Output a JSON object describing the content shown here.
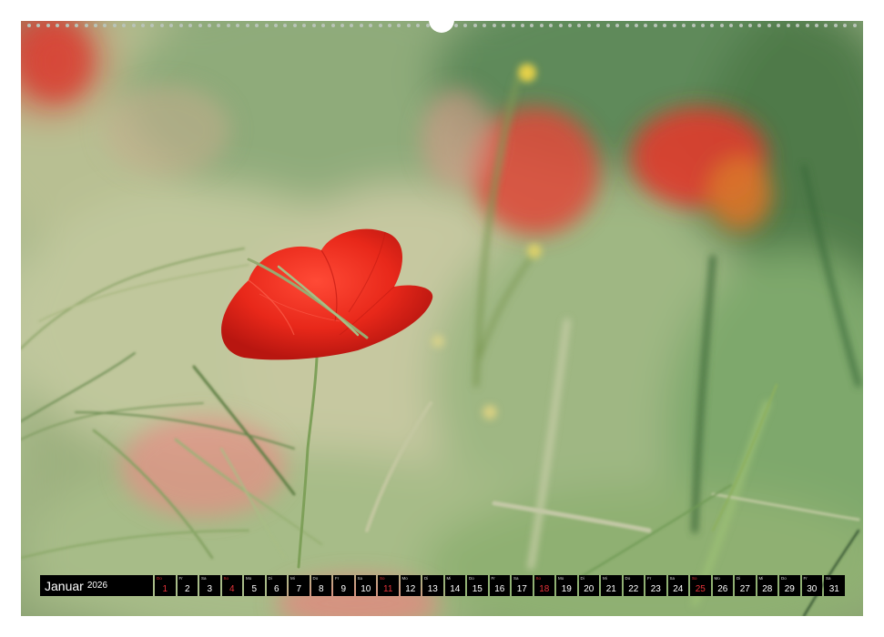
{
  "calendar": {
    "month": "Januar",
    "year": "2026",
    "days": [
      {
        "wd": "Do",
        "n": "1",
        "holiday": true
      },
      {
        "wd": "Fr",
        "n": "2",
        "holiday": false
      },
      {
        "wd": "Sa",
        "n": "3",
        "holiday": false
      },
      {
        "wd": "So",
        "n": "4",
        "holiday": true
      },
      {
        "wd": "Mo",
        "n": "5",
        "holiday": false
      },
      {
        "wd": "Di",
        "n": "6",
        "holiday": false
      },
      {
        "wd": "Mi",
        "n": "7",
        "holiday": false
      },
      {
        "wd": "Do",
        "n": "8",
        "holiday": false
      },
      {
        "wd": "Fr",
        "n": "9",
        "holiday": false
      },
      {
        "wd": "Sa",
        "n": "10",
        "holiday": false
      },
      {
        "wd": "So",
        "n": "11",
        "holiday": true
      },
      {
        "wd": "Mo",
        "n": "12",
        "holiday": false
      },
      {
        "wd": "Di",
        "n": "13",
        "holiday": false
      },
      {
        "wd": "Mi",
        "n": "14",
        "holiday": false
      },
      {
        "wd": "Do",
        "n": "15",
        "holiday": false
      },
      {
        "wd": "Fr",
        "n": "16",
        "holiday": false
      },
      {
        "wd": "Sa",
        "n": "17",
        "holiday": false
      },
      {
        "wd": "So",
        "n": "18",
        "holiday": true
      },
      {
        "wd": "Mo",
        "n": "19",
        "holiday": false
      },
      {
        "wd": "Di",
        "n": "20",
        "holiday": false
      },
      {
        "wd": "Mi",
        "n": "21",
        "holiday": false
      },
      {
        "wd": "Do",
        "n": "22",
        "holiday": false
      },
      {
        "wd": "Fr",
        "n": "23",
        "holiday": false
      },
      {
        "wd": "Sa",
        "n": "24",
        "holiday": false
      },
      {
        "wd": "So",
        "n": "25",
        "holiday": true
      },
      {
        "wd": "Mo",
        "n": "26",
        "holiday": false
      },
      {
        "wd": "Di",
        "n": "27",
        "holiday": false
      },
      {
        "wd": "Mi",
        "n": "28",
        "holiday": false
      },
      {
        "wd": "Do",
        "n": "29",
        "holiday": false
      },
      {
        "wd": "Fr",
        "n": "30",
        "holiday": false
      },
      {
        "wd": "Sa",
        "n": "31",
        "holiday": false
      }
    ]
  },
  "colors": {
    "holiday": "#e8333a",
    "strip": "#000000",
    "poppy": "#e22a1c"
  }
}
